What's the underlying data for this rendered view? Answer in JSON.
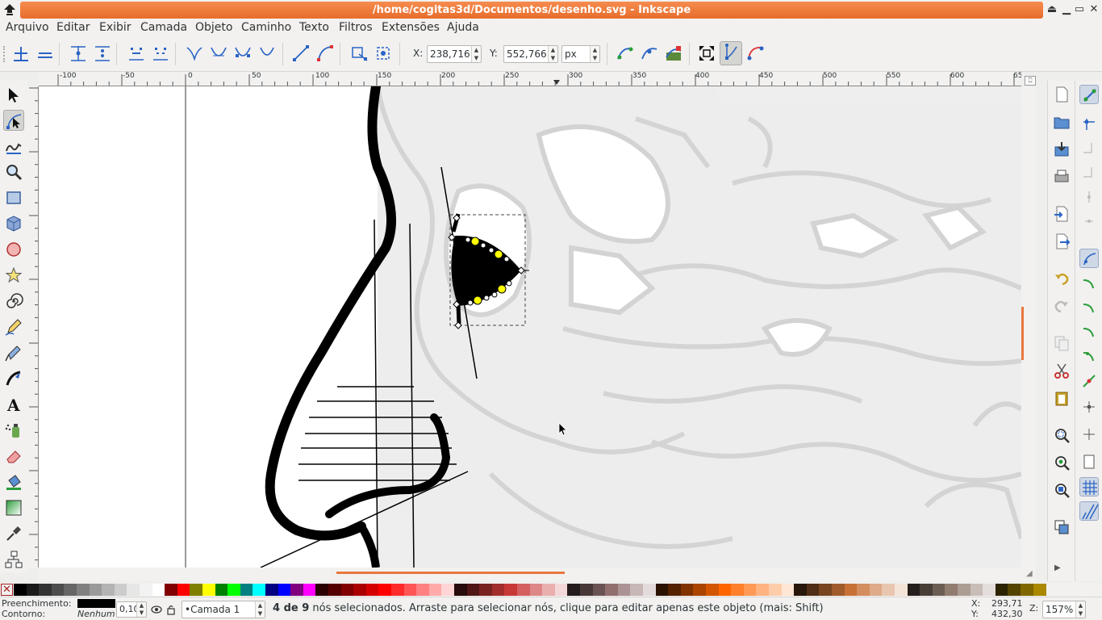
{
  "window": {
    "title": "/home/cogitas3d/Documentos/desenho.svg - Inkscape",
    "minimize_glyph": "▁",
    "maximize_glyph": "▭",
    "close_glyph": "✕",
    "shade_glyph": "⏏"
  },
  "menu": [
    "Arquivo",
    "Editar",
    "Exibir",
    "Camada",
    "Objeto",
    "Caminho",
    "Texto",
    "Filtros",
    "Extensões",
    "Ajuda"
  ],
  "tool_controls": {
    "x_label": "X:",
    "x_value": "238,716",
    "y_label": "Y:",
    "y_value": "552,766",
    "unit": "px"
  },
  "ruler": {
    "h_labels": [
      "-100",
      "-50",
      "0",
      "50",
      "100",
      "150",
      "200",
      "250",
      "300",
      "350",
      "400",
      "450",
      "500",
      "550",
      "600",
      "65"
    ]
  },
  "palette": {
    "none_glyph": "✕",
    "colors": [
      "#000000",
      "#1a1a1a",
      "#333333",
      "#4d4d4d",
      "#666666",
      "#808080",
      "#999999",
      "#b3b3b3",
      "#cccccc",
      "#e6e6e6",
      "#f2f2f2",
      "#ffffff",
      "#800000",
      "#ff0000",
      "#808000",
      "#ffff00",
      "#008000",
      "#00ff00",
      "#008080",
      "#00ffff",
      "#000080",
      "#0000ff",
      "#800080",
      "#ff00ff",
      "#2b0000",
      "#550000",
      "#800000",
      "#aa0000",
      "#d40000",
      "#ff0000",
      "#ff2a2a",
      "#ff5555",
      "#ff8080",
      "#ffaaaa",
      "#ffd5d5",
      "#280b0b",
      "#501616",
      "#782121",
      "#a02c2c",
      "#c83737",
      "#d35f5f",
      "#de8787",
      "#e9afaf",
      "#f4d7d7",
      "#241c1c",
      "#483737",
      "#6c5353",
      "#916f6f",
      "#ac9393",
      "#c8b7b7",
      "#e3dbdb",
      "#2b1100",
      "#552200",
      "#803300",
      "#aa4400",
      "#d45500",
      "#ff6600",
      "#ff7f2a",
      "#ff9955",
      "#ffb380",
      "#ffccaa",
      "#ffe6d5",
      "#28170b",
      "#502d16",
      "#784421",
      "#a05a2c",
      "#c87137",
      "#d38d5f",
      "#deaa87",
      "#e9c6af",
      "#f4e3d7",
      "#241f1c",
      "#483e37",
      "#6c5d53",
      "#917c6f",
      "#ac9d93",
      "#c8beb7",
      "#e3dedb",
      "#2b2200",
      "#554400",
      "#806600",
      "#aa8800"
    ]
  },
  "status": {
    "fill_label": "Preenchimento:",
    "stroke_label": "Contorno:",
    "stroke_value": "Nenhum",
    "opacity_value": "0,10",
    "layer_value": "•Camada 1",
    "message_bold": "4 de 9",
    "message": " nós selecionados. Arraste para selecionar nós, clique para editar apenas este objeto (mais: Shift)",
    "x_coord_label": "X:",
    "x_coord": "293,71",
    "y_coord_label": "Y:",
    "y_coord": "432,30",
    "zoom_label": "Z:",
    "zoom_value": "157%"
  },
  "colors": {
    "title_accent": "#e86c2c",
    "node_selected": "#ffff00",
    "background_image": "#e8e8e8"
  }
}
